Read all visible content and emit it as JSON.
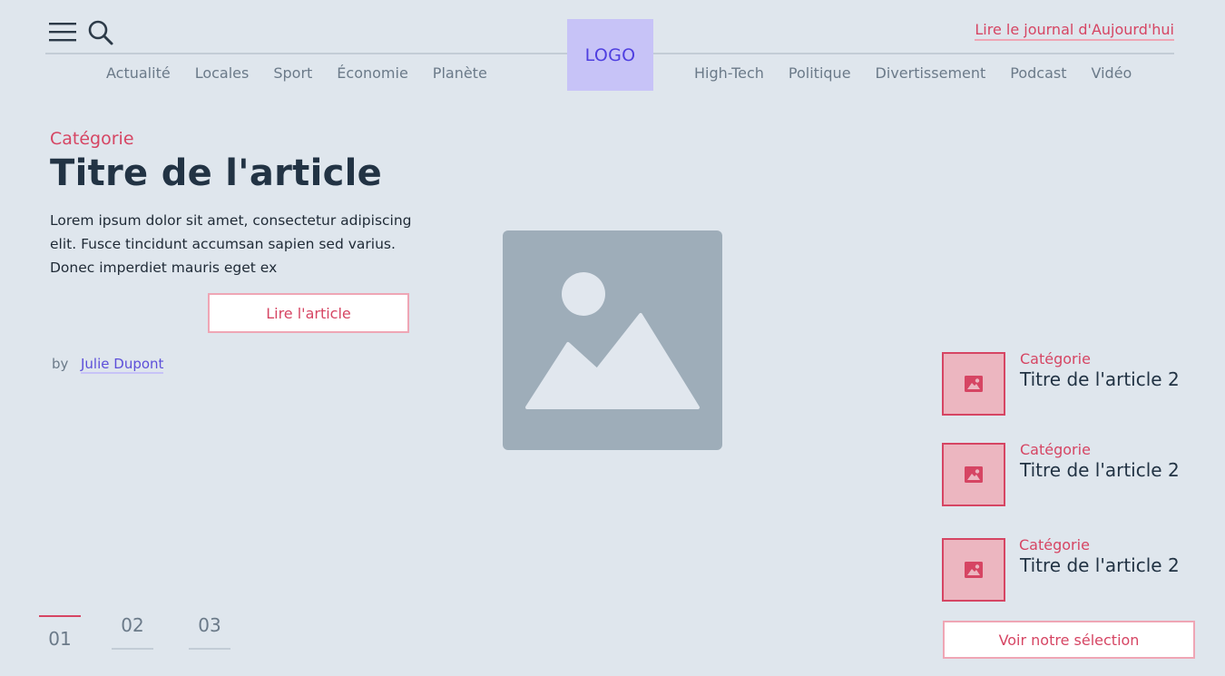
{
  "header": {
    "logo": "LOGO",
    "today_link": "Lire le journal d'Aujourd'hui",
    "nav_left": [
      "Actualité",
      "Locales",
      "Sport",
      "Économie",
      "Planète"
    ],
    "nav_right": [
      "High-Tech",
      "Politique",
      "Divertissement",
      "Podcast",
      "Vidéo"
    ]
  },
  "article": {
    "category": "Catégorie",
    "title": "Titre de l'article",
    "excerpt": "Lorem ipsum dolor sit amet, consectetur adipiscing elit. Fusce tincidunt accumsan sapien sed varius. Donec imperdiet mauris eget ex",
    "read_button": "Lire l'article",
    "by_label": "by",
    "author": "Julie Dupont"
  },
  "side_list": {
    "items": [
      {
        "category": "Catégorie",
        "title": "Titre de l'article 2"
      },
      {
        "category": "Catégorie",
        "title": "Titre de l'article 2"
      },
      {
        "category": "Catégorie",
        "title": "Titre de l'article 2"
      }
    ],
    "button": "Voir notre sélection"
  },
  "pagination": {
    "pages": [
      "01",
      "02",
      "03"
    ],
    "active": "01"
  },
  "colors": {
    "accent": "#d64563",
    "logo_bg": "#c7c3f7",
    "author_link": "#5d4fd9",
    "background": "#dfe6ed",
    "placeholder": "#9eadb9"
  },
  "icons": {
    "menu": "hamburger-menu-icon",
    "search": "search-icon",
    "hero": "image-placeholder-icon",
    "thumb": "image-icon"
  }
}
